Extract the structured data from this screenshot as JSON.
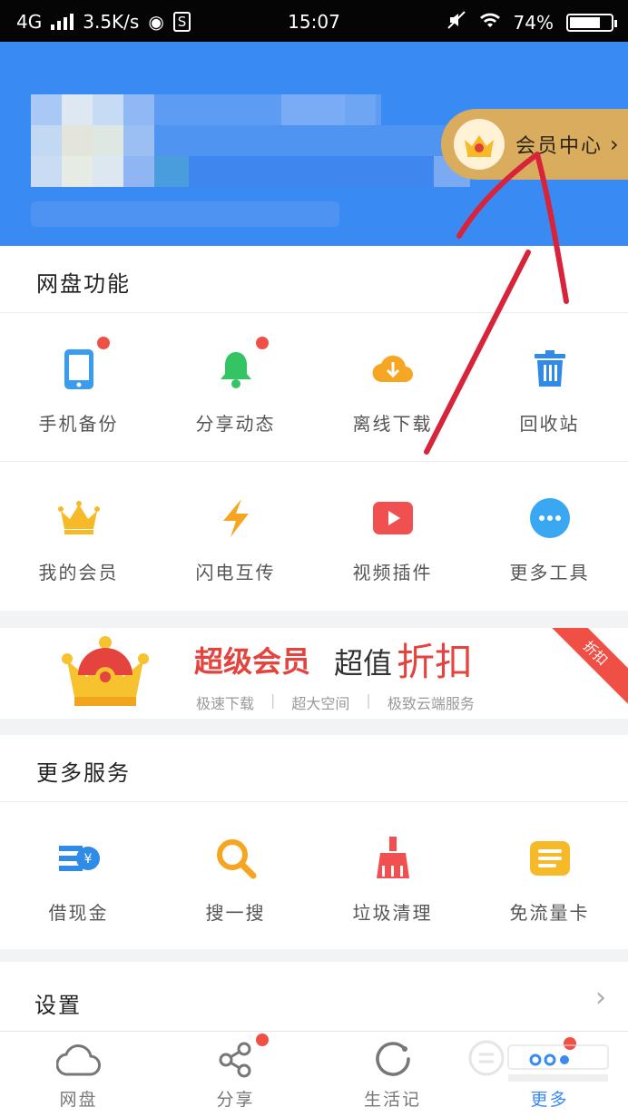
{
  "status_bar": {
    "network": "4G",
    "speed": "3.5K/s",
    "time": "15:07",
    "battery": "74%",
    "battery_level": 0.74
  },
  "header": {
    "vip_center_label": "会员中心"
  },
  "netdisk_section": {
    "title": "网盘功能",
    "row1": [
      {
        "label": "手机备份",
        "icon": "phone-icon",
        "color": "#3a9cf0",
        "badge": true
      },
      {
        "label": "分享动态",
        "icon": "bell-icon",
        "color": "#35c463",
        "badge": true
      },
      {
        "label": "离线下载",
        "icon": "cloud-download-icon",
        "color": "#f5a623",
        "badge": false
      },
      {
        "label": "回收站",
        "icon": "trash-icon",
        "color": "#2f8ae8",
        "badge": false
      }
    ],
    "row2": [
      {
        "label": "我的会员",
        "icon": "crown-icon",
        "color": "#f6b928"
      },
      {
        "label": "闪电互传",
        "icon": "lightning-icon",
        "color": "#f6a523"
      },
      {
        "label": "视频插件",
        "icon": "video-play-icon",
        "color": "#f05050"
      },
      {
        "label": "更多工具",
        "icon": "more-dots-icon",
        "color": "#3aa7f2"
      }
    ]
  },
  "banner": {
    "title_bold": "超级会员",
    "title_normal": "超值",
    "title_big": "折扣",
    "features": [
      "极速下载",
      "超大空间",
      "极致云端服务"
    ],
    "ribbon": "折扣"
  },
  "more_services": {
    "title": "更多服务",
    "items": [
      {
        "label": "借现金",
        "icon": "cash-loan-icon",
        "color": "#2f8ae8"
      },
      {
        "label": "搜一搜",
        "icon": "search-icon",
        "color": "#f6a523"
      },
      {
        "label": "垃圾清理",
        "icon": "broom-icon",
        "color": "#f05050"
      },
      {
        "label": "免流量卡",
        "icon": "data-card-icon",
        "color": "#f6b928"
      }
    ]
  },
  "settings": {
    "label": "设置"
  },
  "tab_bar": {
    "tabs": [
      {
        "label": "网盘",
        "icon": "cloud-icon",
        "badge": false,
        "active": false
      },
      {
        "label": "分享",
        "icon": "share-icon",
        "badge": true,
        "active": false
      },
      {
        "label": "生活记",
        "icon": "life-record-icon",
        "badge": false,
        "active": false
      },
      {
        "label": "更多",
        "icon": "more-grid-icon",
        "badge": true,
        "active": true
      }
    ]
  },
  "colors": {
    "header_blue": "#3a8af4",
    "vip_gold": "#d9ad5d",
    "badge_red": "#ef4f45",
    "annotation_red": "#d8243a"
  }
}
